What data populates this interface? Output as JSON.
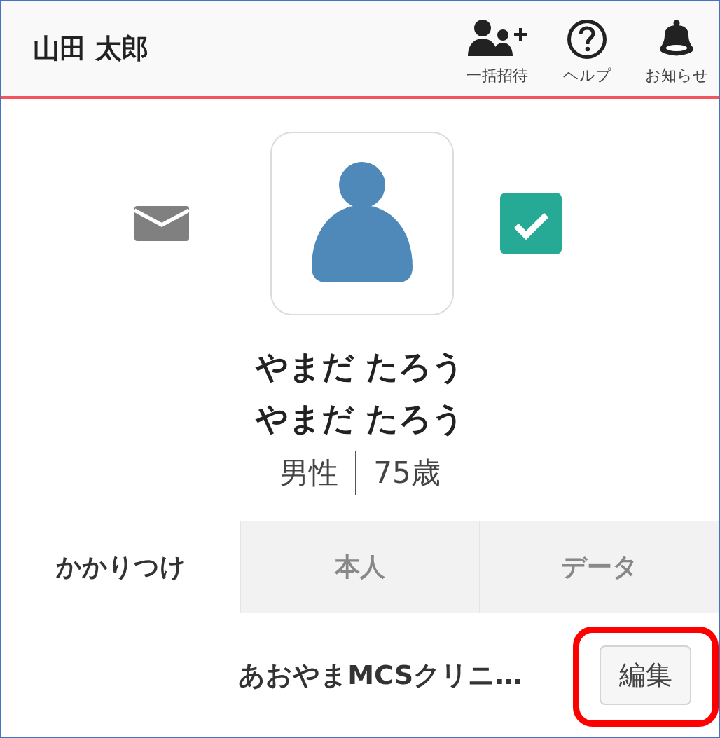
{
  "header": {
    "title": "山田 太郎",
    "tools": [
      {
        "kind": "invite",
        "label": "一括招待"
      },
      {
        "kind": "help",
        "label": "ヘルプ"
      },
      {
        "kind": "notifications",
        "label": "お知らせ"
      }
    ]
  },
  "profile": {
    "verified": true,
    "name_lines": [
      "やまだ たろう",
      "やまだ たろう"
    ],
    "gender": "男性",
    "age": "75歳"
  },
  "tabs": [
    {
      "label": "かかりつけ",
      "selected": true
    },
    {
      "label": "本人",
      "selected": false
    },
    {
      "label": "データ",
      "selected": false
    }
  ],
  "clinic": {
    "name": "あおやまMCSクリニ…",
    "edit_button": {
      "label": "編集",
      "highlighted": true
    }
  }
}
